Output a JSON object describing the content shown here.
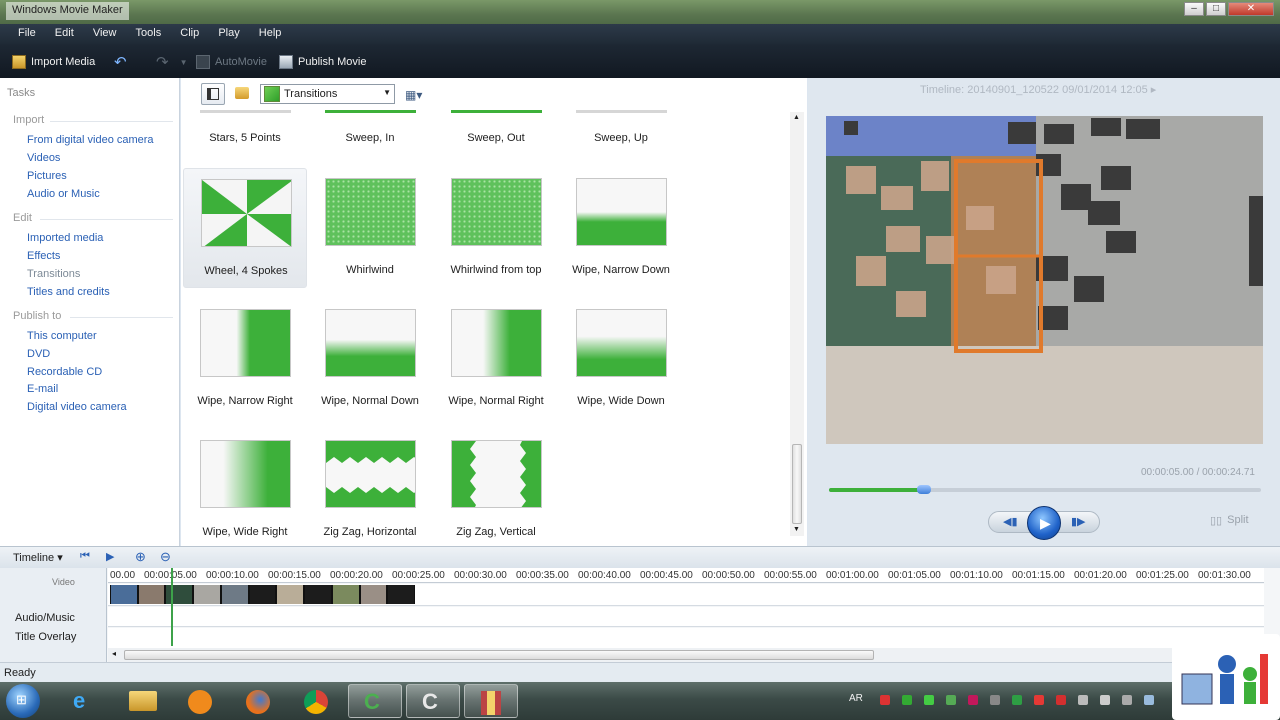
{
  "window": {
    "title": "Windows Movie Maker"
  },
  "menu": [
    "File",
    "Edit",
    "View",
    "Tools",
    "Clip",
    "Play",
    "Help"
  ],
  "toolbar": {
    "import_label": "Import Media",
    "automovie_label": "AutoMovie",
    "publish_label": "Publish Movie"
  },
  "tasks": {
    "header": "Tasks",
    "import": {
      "title": "Import",
      "items": [
        "From digital video camera",
        "Videos",
        "Pictures",
        "Audio or Music"
      ]
    },
    "edit": {
      "title": "Edit",
      "items": [
        "Imported media",
        "Effects",
        "Transitions",
        "Titles and credits"
      ]
    },
    "publish": {
      "title": "Publish to",
      "items": [
        "This computer",
        "DVD",
        "Recordable CD",
        "E-mail",
        "Digital video camera"
      ]
    }
  },
  "content": {
    "dropdown_value": "Transitions",
    "top_row": [
      "Stars, 5 Points",
      "Sweep, In",
      "Sweep, Out",
      "Sweep, Up"
    ],
    "transitions": [
      "Wheel, 4 Spokes",
      "Whirlwind",
      "Whirlwind from top",
      "Wipe, Narrow Down",
      "Wipe, Narrow Right",
      "Wipe, Normal Down",
      "Wipe, Normal Right",
      "Wipe, Wide Down",
      "Wipe, Wide Right",
      "Zig Zag, Horizontal",
      "Zig Zag, Vertical"
    ]
  },
  "preview": {
    "title": "Timeline: 20140901_120522 09/01/2014 12:05 ▸",
    "time": "00:00:05.00 / 00:00:24.71",
    "progress": 0.22,
    "split_label": "Split"
  },
  "timeline": {
    "label": "Timeline",
    "tracks": [
      "Video",
      "Audio/Music",
      "Title Overlay"
    ],
    "ruler": [
      "00.00",
      "00:00:05.00",
      "00:00:10.00",
      "00:00:15.00",
      "00:00:20.00",
      "00:00:25.00",
      "00:00:30.00",
      "00:00:35.00",
      "00:00:40.00",
      "00:00:45.00",
      "00:00:50.00",
      "00:00:55.00",
      "00:01:00.00",
      "00:01:05.00",
      "00:01:10.00",
      "00:01:15.00",
      "00:01:20.00",
      "00:01:25.00",
      "00:01:30.00"
    ]
  },
  "status": "Ready",
  "taskbar": {
    "lang": "AR"
  },
  "colors": {
    "accent_green": "#3db03a",
    "link_blue": "#2b61b5",
    "toolbar_dark": "#1e2834"
  }
}
